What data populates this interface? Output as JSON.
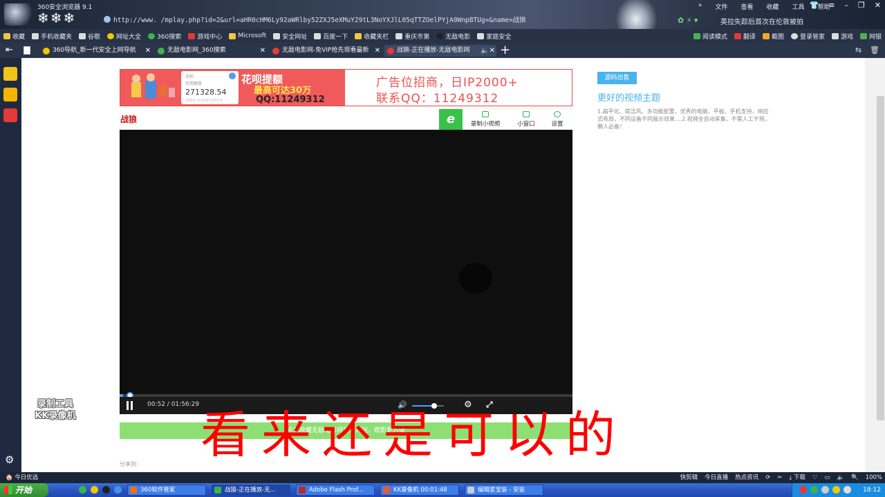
{
  "window": {
    "app_title": "360安全浏览器 9.1",
    "url": "http://www.        /mplay.php?id=2&url=aHR0cHM6Ly92aWRlby52ZXJ5eXMuY29tL3NoYXJlL05qTTZOelPYjA0WnpBTUg=&name=战狼",
    "menus": [
      "文件",
      "查看",
      "收藏",
      "工具",
      "帮助"
    ],
    "news_ticker": "英拉失踪后首次在伦敦被拍"
  },
  "bookmarks": {
    "items": [
      "收藏",
      "手机收藏夹",
      "谷歌",
      "网址大全",
      "360搜索",
      "游戏中心",
      "Microsoft",
      "安全网址",
      "百度一下",
      "收藏夹栏",
      "重庆市第",
      "无敌电影",
      "家庭安全"
    ],
    "right_items": [
      "阅读模式",
      "翻译",
      "截图",
      "登录管家",
      "游戏",
      "网银"
    ]
  },
  "tabs": [
    {
      "label": "360导航_新一代安全上网导航"
    },
    {
      "label": "无敌电影网_360搜索"
    },
    {
      "label": "无敌电影网-免VIP抢先观看最新"
    },
    {
      "label": "战狼-正在播放-无敌电影网"
    }
  ],
  "banner": {
    "card_label": "花呗",
    "card_sub": "可用额度",
    "card_amount": "271328.54",
    "card_foot": "还款日   2020年10月X日",
    "ad_line1": "花呗提额",
    "ad_line2": "最高可达30万",
    "ad_line3": "QQ:11249312",
    "ad_right1": "广告位招商，日IP2000+",
    "ad_right2": "联系QQ：11249312"
  },
  "movie": {
    "title": "战狼"
  },
  "player_tools": [
    {
      "label": "录制小视频"
    },
    {
      "label": "小窗口"
    },
    {
      "label": "设置"
    }
  ],
  "player": {
    "time_current": "00:52",
    "time_total": "01:56:29",
    "time_display": "00:52 / 01:56:29",
    "progress_fraction": 0.0074,
    "volume_fraction": 0.7
  },
  "greenbar": {
    "text": "点此收藏无敌电影网官方网站，观影更方便"
  },
  "share": {
    "label": "分享到："
  },
  "side": {
    "button": "源码出售",
    "title": "更好的视频主题",
    "desc": "1.扁平化、简洁风、多功能配置，优秀的电脑、平板、手机支持，响应式布局，不同设备不同展示效果....2.视频全自动采集，不需人工干预，懒人必备！"
  },
  "overlay": {
    "kk_line1": "录制工具",
    "kk_line2": "KK录像机",
    "caption": "看来还是可以的"
  },
  "statusbar": {
    "left": "今日优选",
    "right_items": [
      "快剪辑",
      "今日直播",
      "热点资讯",
      "下载",
      "100%"
    ]
  },
  "taskbar": {
    "start": "开始",
    "tasks": [
      "360软件管家",
      "战狼-正在播放-无...",
      "Adobe Flash Prof...",
      "KK录像机 00:01:48",
      "编辑星宝装 - 安装"
    ],
    "clock": "18:12"
  },
  "colors": {
    "accent_blue": "#48b3ec",
    "title_red": "#c81414",
    "green_bar": "#8ddf74",
    "caption_red": "#ff0000"
  }
}
